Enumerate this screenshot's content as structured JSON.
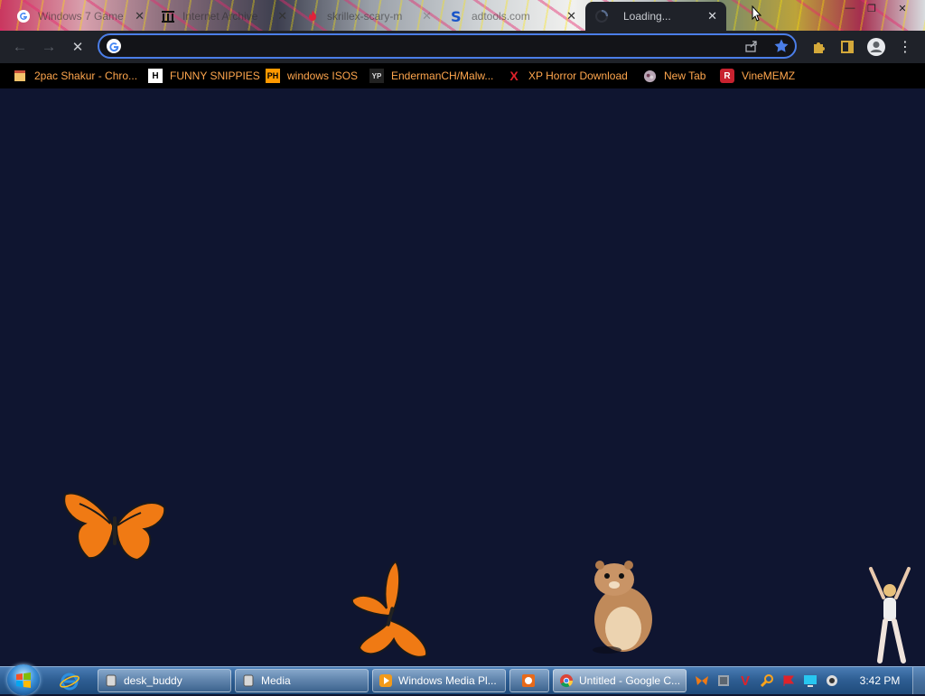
{
  "browser": {
    "tabs": [
      {
        "label": "Windows 7 Game",
        "favicon": "google-g-icon"
      },
      {
        "label": "Internet Archive",
        "favicon": "archive-icon"
      },
      {
        "label": "skrillex-scary-m",
        "favicon": "flame-icon"
      },
      {
        "label": "adtools.com",
        "favicon": "s-icon"
      },
      {
        "label": "Loading...",
        "favicon": "loading-spinner-icon",
        "active": true
      }
    ],
    "omnibox": {
      "value": "",
      "placeholder": ""
    },
    "bookmarks": [
      {
        "label": "2pac Shakur - Chro...",
        "icon": "bookmark-page-icon"
      },
      {
        "label": "FUNNY SNIPPIES",
        "icon": "h-letter-icon",
        "badge": "H"
      },
      {
        "label": "windows ISOS",
        "icon": "ph-icon",
        "badge": "PH"
      },
      {
        "label": "EndermanCH/Malw...",
        "icon": "yp-icon",
        "badge": "YP"
      },
      {
        "label": "XP Horror Download",
        "icon": "x-letter-icon",
        "badge": "X"
      },
      {
        "label": "New Tab",
        "icon": "globe-avatar-icon"
      },
      {
        "label": "VineMEMZ",
        "icon": "r-letter-icon",
        "badge": "R"
      }
    ],
    "colors": {
      "bookmark_text": "#ffa64d",
      "accent": "#4b7ee8",
      "page_bg": "#0f1530"
    }
  },
  "taskbar": {
    "items": [
      {
        "label": "desk_buddy",
        "icon": "app-window-icon"
      },
      {
        "label": "Media",
        "icon": "app-window-icon"
      },
      {
        "label": "Windows Media Pl...",
        "icon": "media-player-icon"
      },
      {
        "label": "",
        "icon": "puzzle-app-icon"
      },
      {
        "label": "Untitled - Google C...",
        "icon": "chrome-icon"
      }
    ],
    "clock": "3:42 PM"
  }
}
